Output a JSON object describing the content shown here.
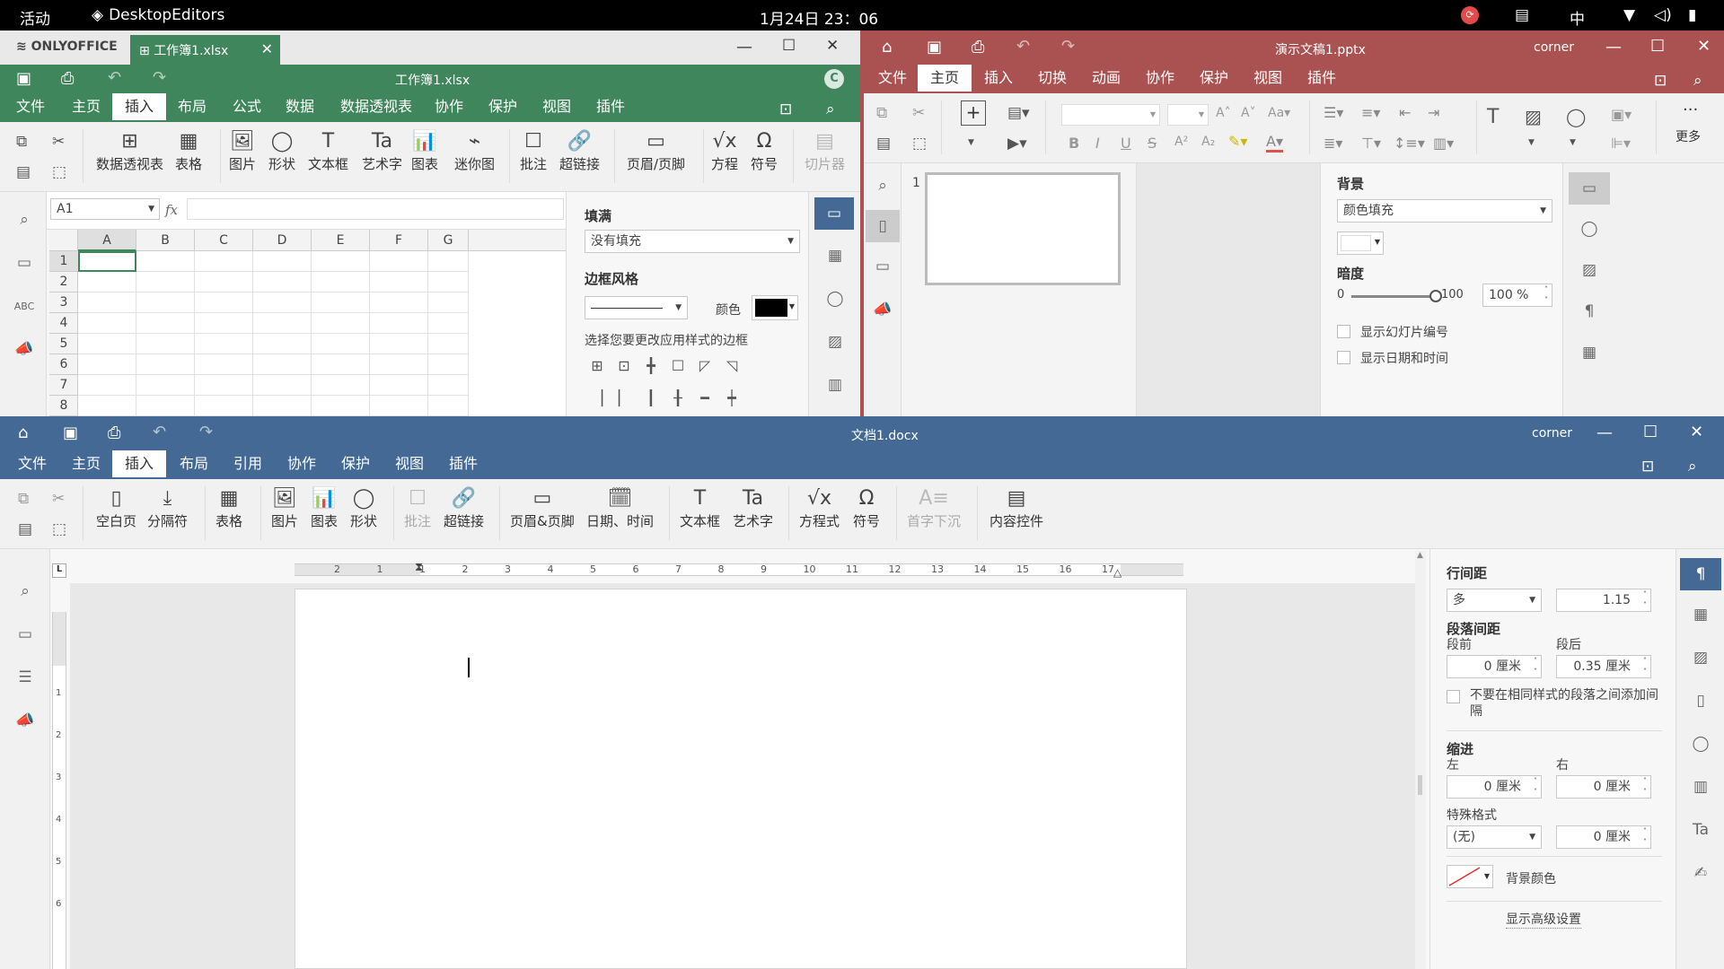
{
  "topbar": {
    "activities": "活动",
    "app": "DesktopEditors",
    "clock": "1月24日 23：06",
    "ime": "中"
  },
  "xlsx": {
    "brand": "ONLYOFFICE",
    "tab_title": "工作簿1.xlsx",
    "doc_title": "工作簿1.xlsx",
    "avatar": "C",
    "menu": [
      "文件",
      "主页",
      "插入",
      "布局",
      "公式",
      "数据",
      "数据透视表",
      "协作",
      "保护",
      "视图",
      "插件"
    ],
    "active_menu": "插入",
    "toolbar": {
      "pivot": "数据透视表",
      "table": "表格",
      "image": "图片",
      "shape": "形状",
      "textbox": "文本框",
      "textart": "艺术字",
      "chart": "图表",
      "sparkline": "迷你图",
      "comment": "批注",
      "hyperlink": "超链接",
      "headerfooter": "页眉/页脚",
      "equation": "方程",
      "symbol": "符号",
      "slicer": "切片器"
    },
    "namebox": "A1",
    "fx": "fx",
    "columns": [
      "A",
      "B",
      "C",
      "D",
      "E",
      "F",
      "G"
    ],
    "rows": [
      "1",
      "2",
      "3",
      "4",
      "5",
      "6",
      "7",
      "8"
    ],
    "panel": {
      "fill_title": "填满",
      "fill_value": "没有填充",
      "border_title": "边框风格",
      "color_label": "颜色",
      "border_hint": "选择您要更改应用样式的边框"
    }
  },
  "pptx": {
    "doc_title": "演示文稿1.pptx",
    "user": "corner",
    "menu": [
      "文件",
      "主页",
      "插入",
      "切换",
      "动画",
      "协作",
      "保护",
      "视图",
      "插件"
    ],
    "active_menu": "主页",
    "more": "更多",
    "slide_num": "1",
    "panel": {
      "bg_title": "背景",
      "bg_value": "颜色填充",
      "opacity_title": "暗度",
      "opacity_min": "0",
      "opacity_max": "100",
      "opacity_value": "100 %",
      "opacity_level": 1.0,
      "show_slide_number": "显示幻灯片编号",
      "show_datetime": "显示日期和时间"
    }
  },
  "docx": {
    "doc_title": "文档1.docx",
    "user": "corner",
    "menu": [
      "文件",
      "主页",
      "插入",
      "布局",
      "引用",
      "协作",
      "保护",
      "视图",
      "插件"
    ],
    "active_menu": "插入",
    "toolbar": {
      "blank": "空白页",
      "break": "分隔符",
      "table": "表格",
      "image": "图片",
      "chart": "图表",
      "shape": "形状",
      "comment": "批注",
      "hyperlink": "超链接",
      "headerfooter": "页眉&页脚",
      "datetime": "日期、时间",
      "textbox": "文本框",
      "textart": "艺术字",
      "equation": "方程式",
      "symbol": "符号",
      "dropcap": "首字下沉",
      "content": "内容控件"
    },
    "ruler_labels": [
      "2",
      "1",
      "1",
      "2",
      "3",
      "4",
      "5",
      "6",
      "7",
      "8",
      "9",
      "10",
      "11",
      "12",
      "13",
      "14",
      "15",
      "16",
      "17"
    ],
    "vruler_labels": [
      "1",
      "2",
      "3",
      "4",
      "5",
      "6"
    ],
    "panel": {
      "line_spacing_title": "行间距",
      "line_spacing_mode": "多",
      "line_spacing_value": "1.15",
      "para_spacing_title": "段落间距",
      "before_label": "段前",
      "after_label": "段后",
      "before_value": "0 厘米",
      "after_value": "0.35 厘米",
      "no_space_label": "不要在相同样式的段落之间添加间隔",
      "indent_title": "缩进",
      "left_label": "左",
      "right_label": "右",
      "left_value": "0 厘米",
      "right_value": "0 厘米",
      "special_label": "特殊格式",
      "special_value": "(无)",
      "special_amount": "0 厘米",
      "bg_color_label": "背景颜色",
      "advanced": "显示高级设置"
    }
  },
  "colors": {
    "xlsx": "#40865c",
    "pptx": "#aa5252",
    "docx": "#446995"
  }
}
